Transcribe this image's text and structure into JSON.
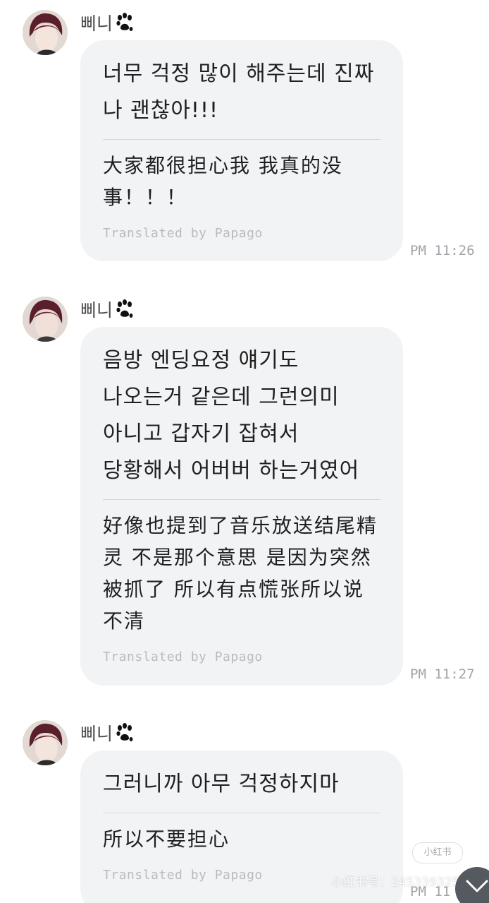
{
  "messages": [
    {
      "sender": "삐니",
      "original": "너무 걱정 많이 해주는데 진짜 나 괜찮아!!!",
      "translation": "大家都很担心我 我真的没事！！！",
      "credit": "Translated by Papago",
      "time": "PM 11:26"
    },
    {
      "sender": "삐니",
      "original": "음방 엔딩요정 얘기도 나오는거 같은데 그런의미 아니고 갑자기 잡혀서 당황해서 어버버 하는거였어",
      "translation": "好像也提到了音乐放送结尾精灵 不是那个意思 是因为突然被抓了 所以有点慌张所以说不清",
      "credit": "Translated by Papago",
      "time": "PM 11:27"
    },
    {
      "sender": "삐니",
      "original": "그러니까 아무 걱정하지마",
      "translation": "所以不要担心",
      "credit": "Translated by Papago",
      "time": "PM 11"
    }
  ],
  "watermark": {
    "text": "小红书号：245339325",
    "badge": "小红书"
  },
  "icons": {
    "sender_badge": "paw-icon",
    "scroll": "chevron-down-icon"
  },
  "colors": {
    "bubble": "#f2f3f5",
    "text": "#1f1f1f",
    "timestamp": "#a0a3a8",
    "credit": "#b8bbc0"
  }
}
